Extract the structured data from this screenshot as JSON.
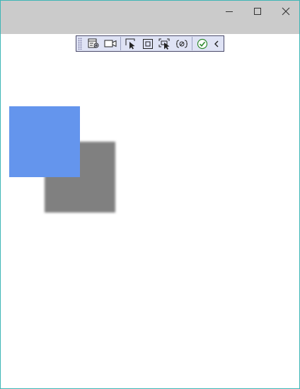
{
  "window": {
    "caption_buttons": {
      "minimize_icon": "minimize-icon",
      "maximize_icon": "maximize-icon",
      "close_icon": "close-icon"
    },
    "titlebar_color": "#cbcbcb",
    "border_color": "#3fb6b6"
  },
  "toolbar": {
    "background": "#dfe3f5",
    "icons": [
      "live-visual-tree-icon",
      "video-camera-icon",
      "select-element-icon",
      "display-layout-adorners-icon",
      "track-focused-element-icon",
      "binding-failures-icon",
      "hot-reload-ok-icon",
      "collapse-chevron-icon"
    ]
  },
  "canvas": {
    "blue_rect_color": "#6495ed",
    "shadow_rect_color": "#808080"
  }
}
